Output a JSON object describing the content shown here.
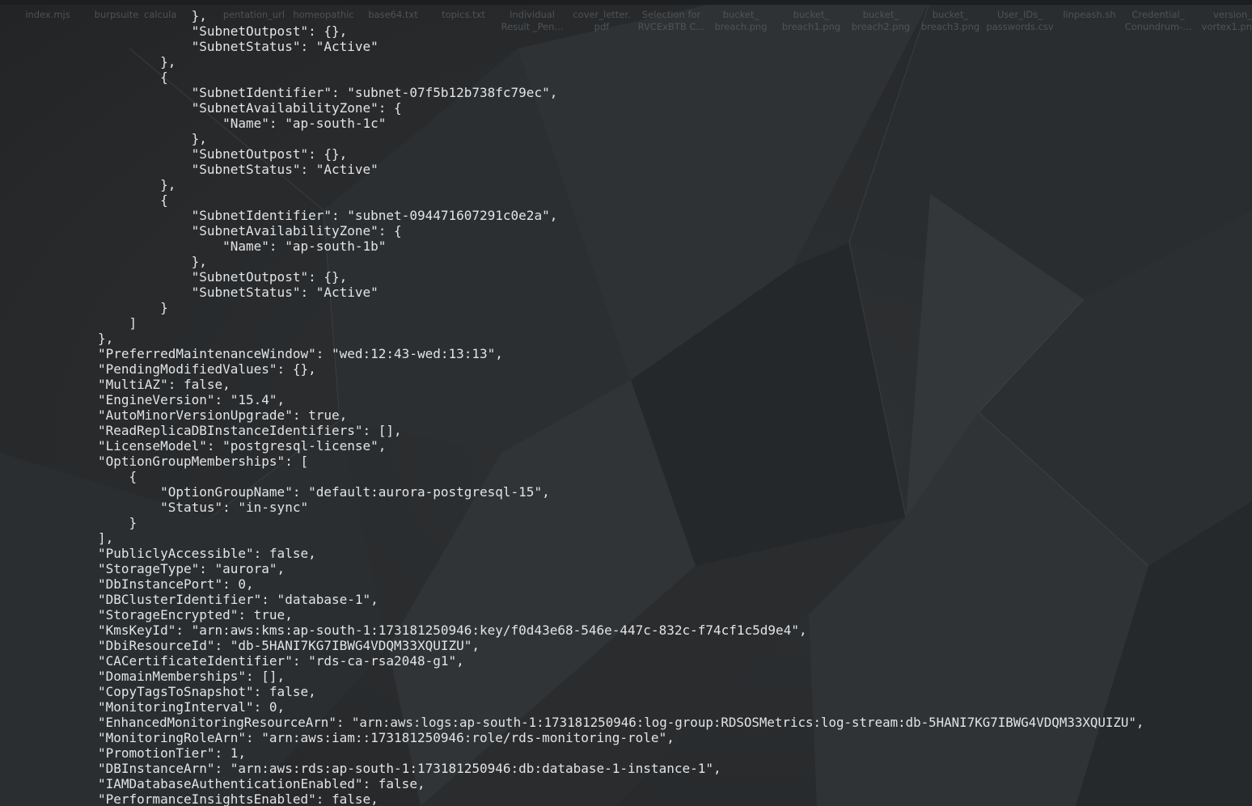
{
  "desktop": {
    "icons": [
      {
        "label": "index.mjs",
        "icon": "file-icon"
      },
      {
        "label": "burpsuite",
        "icon": "app-icon"
      },
      {
        "label": "calcula",
        "icon": "app-icon"
      },
      {
        "label": "pentation_url",
        "icon": "file-icon"
      },
      {
        "label": "homeopathic",
        "icon": "file-icon"
      },
      {
        "label": "base64.txt",
        "icon": "text-file-icon"
      },
      {
        "label": "topics.txt",
        "icon": "text-file-icon"
      },
      {
        "label": "Individual\nResult _Pen...",
        "icon": "file-icon"
      },
      {
        "label": "cover_letter.\npdf",
        "icon": "pdf-icon"
      },
      {
        "label": "Selection for\nRVCExBTB C...",
        "icon": "file-icon"
      },
      {
        "label": "bucket_\nbreach.png",
        "icon": "image-icon"
      },
      {
        "label": "bucket_\nbreach1.png",
        "icon": "image-icon"
      },
      {
        "label": "bucket_\nbreach2.png",
        "icon": "image-icon"
      },
      {
        "label": "bucket_\nbreach3.png",
        "icon": "image-icon"
      },
      {
        "label": "User_IDs_\npasswords.csv",
        "icon": "spreadsheet-icon"
      },
      {
        "label": "linpeash.sh",
        "icon": "script-icon"
      },
      {
        "label": "Credential_\nConundrum-...",
        "icon": "file-icon"
      },
      {
        "label": "version_\nvortex1.pn",
        "icon": "image-icon"
      }
    ]
  },
  "terminal": {
    "lines": [
      "            },",
      "            \"SubnetOutpost\": {},",
      "            \"SubnetStatus\": \"Active\"",
      "        },",
      "        {",
      "            \"SubnetIdentifier\": \"subnet-07f5b12b738fc79ec\",",
      "            \"SubnetAvailabilityZone\": {",
      "                \"Name\": \"ap-south-1c\"",
      "            },",
      "            \"SubnetOutpost\": {},",
      "            \"SubnetStatus\": \"Active\"",
      "        },",
      "        {",
      "            \"SubnetIdentifier\": \"subnet-094471607291c0e2a\",",
      "            \"SubnetAvailabilityZone\": {",
      "                \"Name\": \"ap-south-1b\"",
      "            },",
      "            \"SubnetOutpost\": {},",
      "            \"SubnetStatus\": \"Active\"",
      "        }",
      "    ]",
      "},",
      "\"PreferredMaintenanceWindow\": \"wed:12:43-wed:13:13\",",
      "\"PendingModifiedValues\": {},",
      "\"MultiAZ\": false,",
      "\"EngineVersion\": \"15.4\",",
      "\"AutoMinorVersionUpgrade\": true,",
      "\"ReadReplicaDBInstanceIdentifiers\": [],",
      "\"LicenseModel\": \"postgresql-license\",",
      "\"OptionGroupMemberships\": [",
      "    {",
      "        \"OptionGroupName\": \"default:aurora-postgresql-15\",",
      "        \"Status\": \"in-sync\"",
      "    }",
      "],",
      "\"PubliclyAccessible\": false,",
      "\"StorageType\": \"aurora\",",
      "\"DbInstancePort\": 0,",
      "\"DBClusterIdentifier\": \"database-1\",",
      "\"StorageEncrypted\": true,",
      "\"KmsKeyId\": \"arn:aws:kms:ap-south-1:173181250946:key/f0d43e68-546e-447c-832c-f74cf1c5d9e4\",",
      "\"DbiResourceId\": \"db-5HANI7KG7IBWG4VDQM33XQUIZU\",",
      "\"CACertificateIdentifier\": \"rds-ca-rsa2048-g1\",",
      "\"DomainMemberships\": [],",
      "\"CopyTagsToSnapshot\": false,",
      "\"MonitoringInterval\": 0,",
      "\"EnhancedMonitoringResourceArn\": \"arn:aws:logs:ap-south-1:173181250946:log-group:RDSOSMetrics:log-stream:db-5HANI7KG7IBWG4VDQM33XQUIZU\",",
      "\"MonitoringRoleArn\": \"arn:aws:iam::173181250946:role/rds-monitoring-role\",",
      "\"PromotionTier\": 1,",
      "\"DBInstanceArn\": \"arn:aws:rds:ap-south-1:173181250946:db:database-1-instance-1\",",
      "\"IAMDatabaseAuthenticationEnabled\": false,",
      "\"PerformanceInsightsEnabled\": false,"
    ]
  },
  "colors": {
    "background": "#282b2d",
    "terminal_text": "#e2e4e5",
    "desktop_icon_label": "#4e5356"
  }
}
